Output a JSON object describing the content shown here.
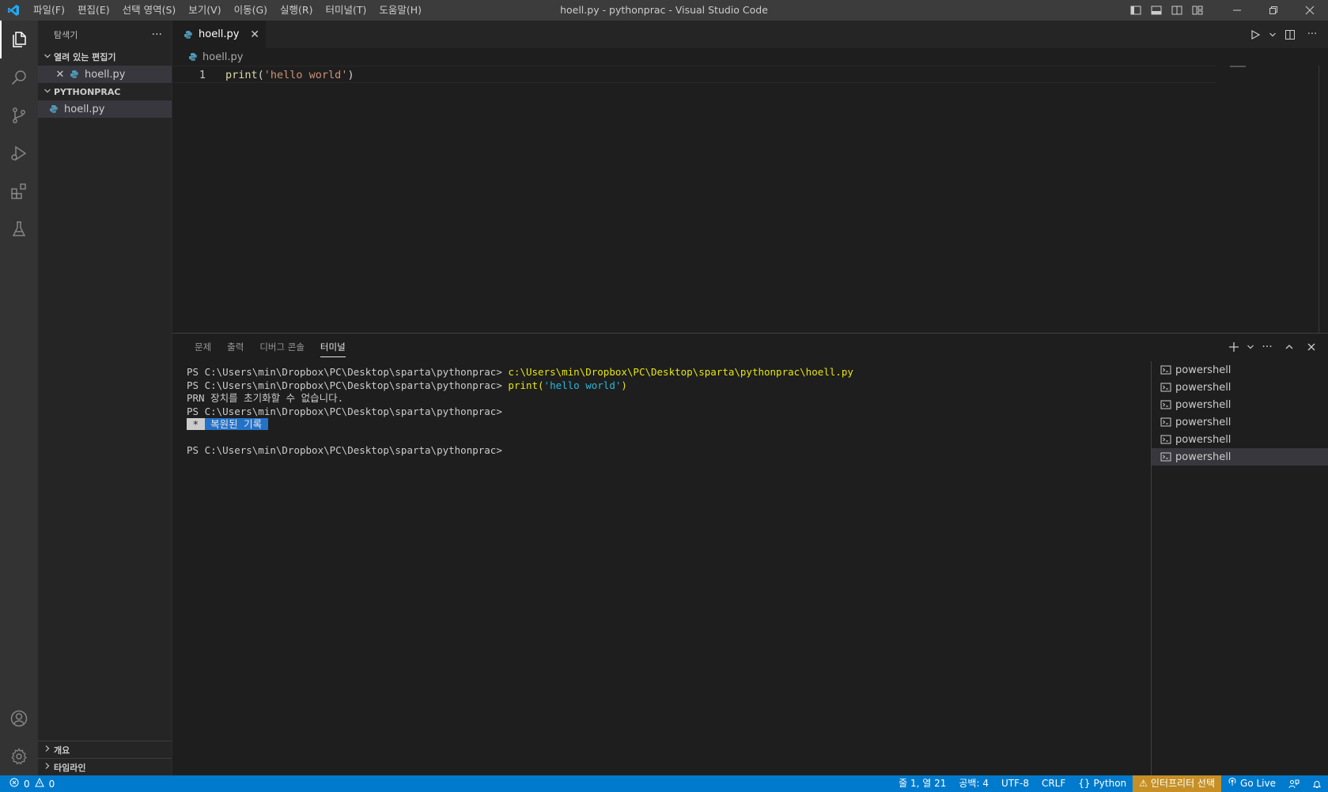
{
  "window": {
    "title": "hoell.py - pythonprac - Visual Studio Code",
    "menus": [
      "파일(F)",
      "편집(E)",
      "선택 영역(S)",
      "보기(V)",
      "이동(G)",
      "실행(R)",
      "터미널(T)",
      "도움말(H)"
    ]
  },
  "sidebar": {
    "title": "탐색기",
    "open_editors": {
      "label": "열려 있는 편집기",
      "files": [
        {
          "name": "hoell.py"
        }
      ]
    },
    "folder": {
      "label": "PYTHONPRAC",
      "files": [
        {
          "name": "hoell.py"
        }
      ]
    },
    "outline_label": "개요",
    "timeline_label": "타임라인"
  },
  "editor": {
    "tab_label": "hoell.py",
    "breadcrumb": "hoell.py",
    "line_number": "1",
    "code": {
      "fn": "print",
      "open": "(",
      "str": "'hello world'",
      "close": ")"
    }
  },
  "panel": {
    "tabs": [
      "문제",
      "출력",
      "디버그 콘솔",
      "터미널"
    ],
    "active_tab": "터미널",
    "terminal": {
      "prompt": "PS C:\\Users\\min\\Dropbox\\PC\\Desktop\\sparta\\pythonprac> ",
      "line1_cmd": "c:\\Users\\min\\Dropbox\\PC\\Desktop\\sparta\\pythonprac\\hoell.py",
      "line2_fn": "print(",
      "line2_str": "'hello world'",
      "line2_close": ")",
      "line3": "PRN 장치를 초기화할 수 없습니다.",
      "line4": "PS C:\\Users\\min\\Dropbox\\PC\\Desktop\\sparta\\pythonprac>",
      "restored_star": " * ",
      "restored_text": " 복원된 기록 ",
      "line6": "PS C:\\Users\\min\\Dropbox\\PC\\Desktop\\sparta\\pythonprac>"
    },
    "terminals": [
      "powershell",
      "powershell",
      "powershell",
      "powershell",
      "powershell",
      "powershell"
    ]
  },
  "statusbar": {
    "errors": "0",
    "warnings": "0",
    "position": "줄 1, 열 21",
    "spaces": "공백: 4",
    "encoding": "UTF-8",
    "eol": "CRLF",
    "language": "Python",
    "interpreter": "인터프리터 선택",
    "golive": "Go Live"
  },
  "colors": {
    "accent": "#007acc",
    "warning": "#c69026"
  }
}
